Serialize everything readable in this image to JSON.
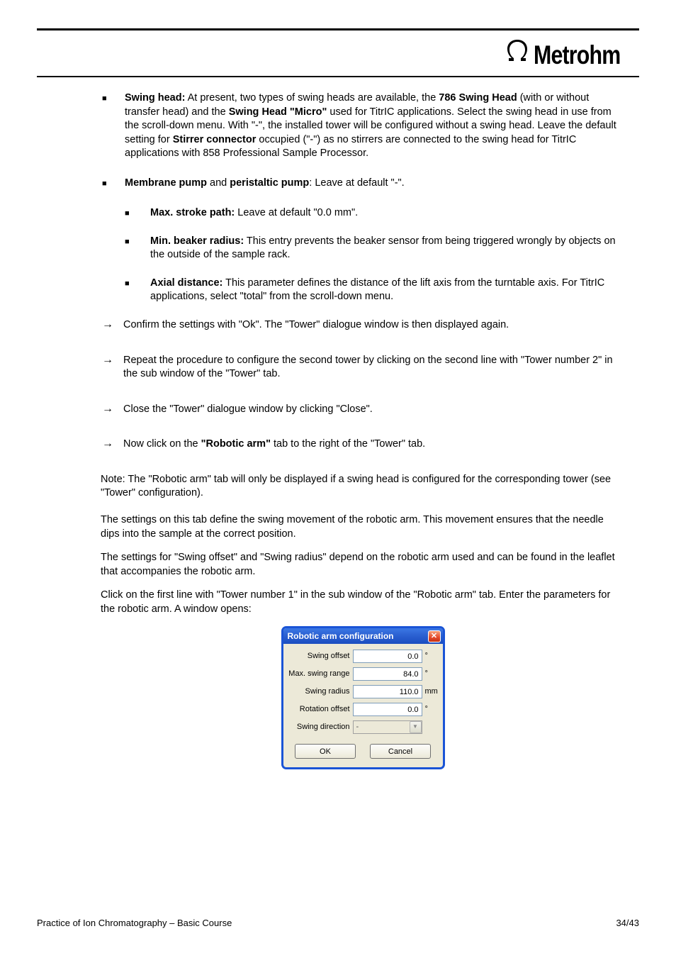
{
  "logo_word": "Metrohm",
  "bullet1": {
    "title": "Swing head:",
    "text": " At present, two types of swing heads are available, the "
  },
  "swing_a": {
    "bold": "786 Swing Head",
    "text": " (with or without transfer head) and the "
  },
  "swing_b": {
    "bold": "Swing Head \"Micro\"",
    "text": " used for TitrIC applications. Select the swing head in use from the scroll-down menu. With \"-\", the installed tower will be configured without a swing head. Leave the default setting for "
  },
  "swing_c": {
    "bold": "Stirrer connector",
    "text": " occupied (\"-\") as no stirrers are connected to the swing head for TitrIC applications with 858 Professional Sample Processor."
  },
  "mp": {
    "bold": "Membrane pump",
    "text": " and "
  },
  "pp": {
    "bold": "peristaltic pump",
    "text": ": Leave at default \"-\"."
  },
  "sub1": {
    "bold": "Max. stroke path:",
    "text": " Leave at default \"0.0 mm\"."
  },
  "sub2": {
    "bold": "Min. beaker radius:",
    "text": " This entry prevents the beaker sensor from being triggered wrongly by objects on the outside of the sample rack."
  },
  "sub3": {
    "bold": "Axial distance:",
    "text": " This parameter defines the distance of the lift axis from the turntable axis. For TitrIC applications, select \"total\" from the scroll-down menu."
  },
  "arrow1": "Confirm the settings with \"Ok\". The \"Tower\" dialogue window is then displayed again.",
  "arrow2": "Repeat the procedure to configure the second tower by clicking on the second line with \"Tower number 2\" in the sub window of the \"Tower\" tab.",
  "arrow3": "Close the \"Tower\" dialogue window by clicking \"Close\".",
  "arrow4_a": "Now click on the ",
  "arrow4_b": "\"Robotic arm\"",
  "arrow4_c": " tab to the right of the \"Tower\" tab.",
  "note1": "Note: The \"Robotic arm\" tab will only be displayed if a swing head is configured for the corresponding tower (see \"Tower\" configuration).",
  "p2": "The settings on this tab define the swing movement of the robotic arm. This movement ensures that the needle dips into the sample at the correct position.",
  "p3": "The settings for \"Swing offset\" and \"Swing radius\" depend on the robotic arm used and can be found in the leaflet that accompanies the robotic arm.",
  "p4": "Click on the first line with \"Tower number 1\" in the sub window of the \"Robotic arm\" tab. Enter the parameters for the robotic arm. A window opens:",
  "dialog": {
    "title": "Robotic arm configuration",
    "rows": {
      "swing_offset": {
        "label": "Swing offset",
        "value": "0.0",
        "unit": "°"
      },
      "max_swing_range": {
        "label": "Max. swing range",
        "value": "84.0",
        "unit": "°"
      },
      "swing_radius": {
        "label": "Swing radius",
        "value": "110.0",
        "unit": "mm"
      },
      "rotation_offset": {
        "label": "Rotation offset",
        "value": "0.0",
        "unit": "°"
      },
      "swing_direction": {
        "label": "Swing direction",
        "value": "-"
      }
    },
    "ok": "OK",
    "cancel": "Cancel"
  },
  "footer": {
    "left": "Practice of Ion Chromatography – Basic Course",
    "right": "34/43"
  }
}
